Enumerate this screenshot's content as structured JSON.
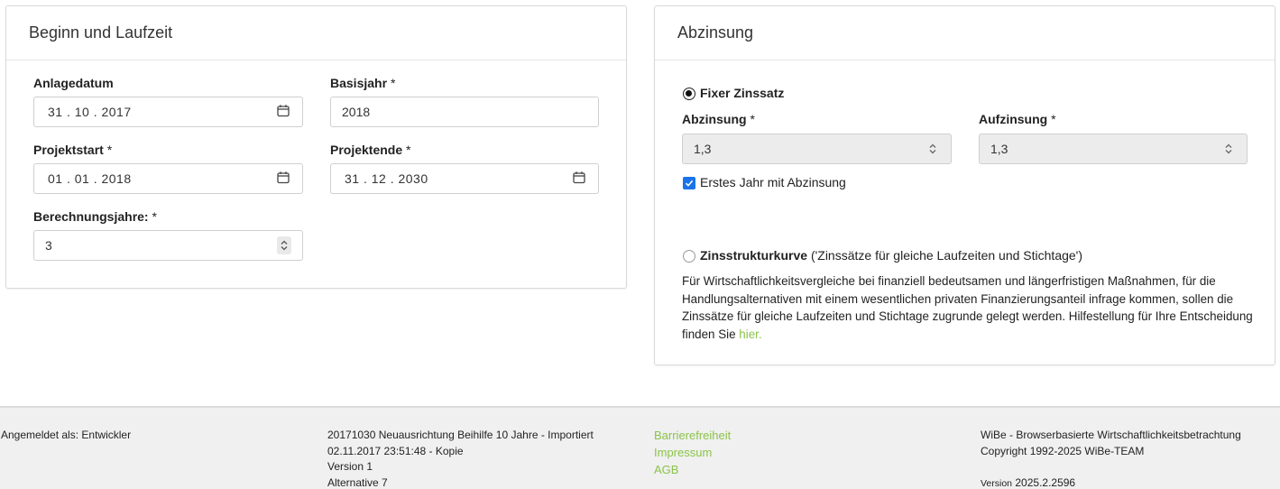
{
  "beginn": {
    "title": "Beginn und Laufzeit",
    "anlagedatum": {
      "label": "Anlagedatum",
      "value": "31 . 10 . 2017"
    },
    "basisjahr": {
      "label": "Basisjahr",
      "required": "*",
      "value": "2018"
    },
    "projektstart": {
      "label": "Projektstart",
      "required": "*",
      "value": "01 . 01 . 2018"
    },
    "projektende": {
      "label": "Projektende",
      "required": "*",
      "value": "31 . 12 . 2030"
    },
    "berechnungsjahre": {
      "label": "Berechnungsjahre:",
      "required": "*",
      "value": "3"
    }
  },
  "abzinsung": {
    "title": "Abzinsung",
    "fixer": {
      "label": "Fixer Zinssatz",
      "checked": true
    },
    "abzinsung_field": {
      "label": "Abzinsung",
      "required": "*",
      "value": "1,3"
    },
    "aufzinsung_field": {
      "label": "Aufzinsung",
      "required": "*",
      "value": "1,3"
    },
    "erstes_jahr": {
      "label": "Erstes Jahr mit Abzinsung",
      "checked": true
    },
    "zinsstruktur": {
      "label": "Zinsstrukturkurve",
      "note": "('Zinssätze für gleiche Laufzeiten und Stichtage')",
      "checked": false
    },
    "description": "Für Wirtschaftlichkeitsvergleiche bei finanziell bedeutsamen und längerfristigen Maßnahmen, für die Handlungsalternativen mit einem wesentlichen privaten Finanzierungsanteil infrage kommen, sollen die Zinssätze für gleiche Laufzeiten und Stichtage zugrunde gelegt werden. Hilfestellung für Ihre Entscheidung finden Sie",
    "link": "hier."
  },
  "footer": {
    "user": "Angemeldet als: Entwickler",
    "project_line1": "20171030 Neuausrichtung Beihilfe 10 Jahre - Importiert",
    "project_line2": "02.11.2017 23:51:48 - Kopie",
    "project_line3": "Version 1",
    "project_line4": "Alternative 7",
    "links": [
      "Barrierefreiheit",
      "Impressum",
      "AGB"
    ],
    "app_name": "WiBe - Browserbasierte Wirtschaftlichkeitsbetrachtung",
    "copyright": "Copyright 1992-2025 WiBe-TEAM",
    "version_label": "Version",
    "version": "2025.2.2596"
  },
  "colors": {
    "link": "#8bc34a",
    "checkbox": "#1a73e8",
    "footer_bg": "#f0f0f0"
  }
}
